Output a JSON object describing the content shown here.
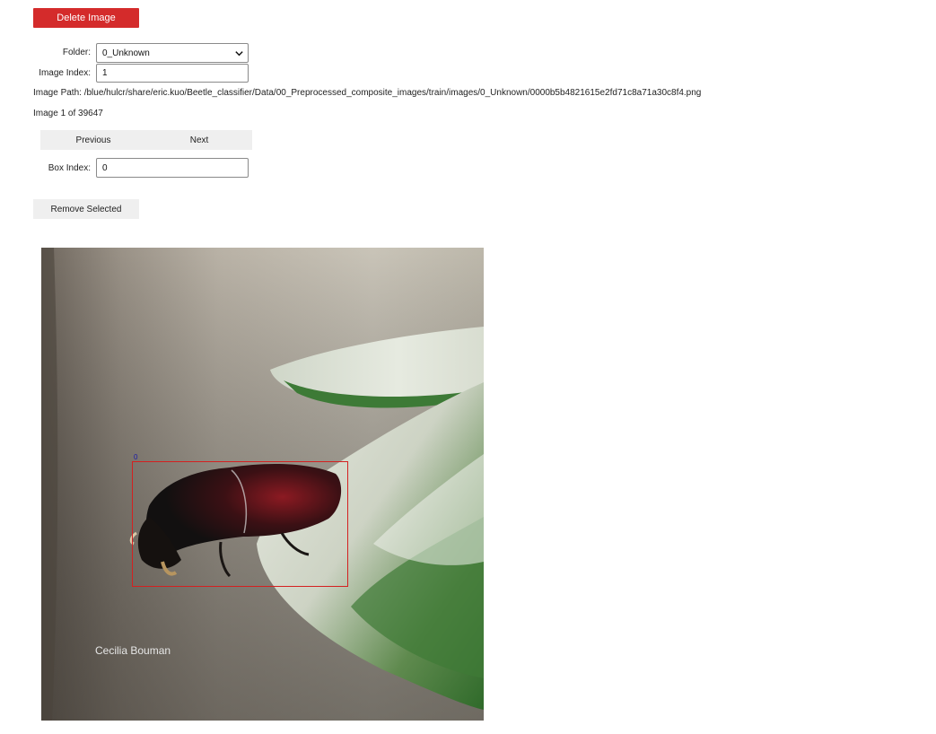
{
  "toolbar": {
    "delete_label": "Delete Image",
    "delete_color": "#d42b2b"
  },
  "form": {
    "folder_label": "Folder:",
    "folder_value": "0_Unknown",
    "image_index_label": "Image Index:",
    "image_index_value": "1",
    "image_path_text": "Image Path: /blue/hulcr/share/eric.kuo/Beetle_classifier/Data/00_Preprocessed_composite_images/train/images/0_Unknown/0000b5b4821615e2fd71c8a71a30c8f4.png",
    "image_count_text": "Image 1 of 39647",
    "box_index_label": "Box Index:",
    "box_index_value": "0"
  },
  "nav": {
    "previous_label": "Previous",
    "next_label": "Next"
  },
  "actions": {
    "remove_selected_label": "Remove Selected"
  },
  "viewer": {
    "bbox_label": "0",
    "bbox_color": "#d42020",
    "watermark": "Cecilia Bouman"
  }
}
